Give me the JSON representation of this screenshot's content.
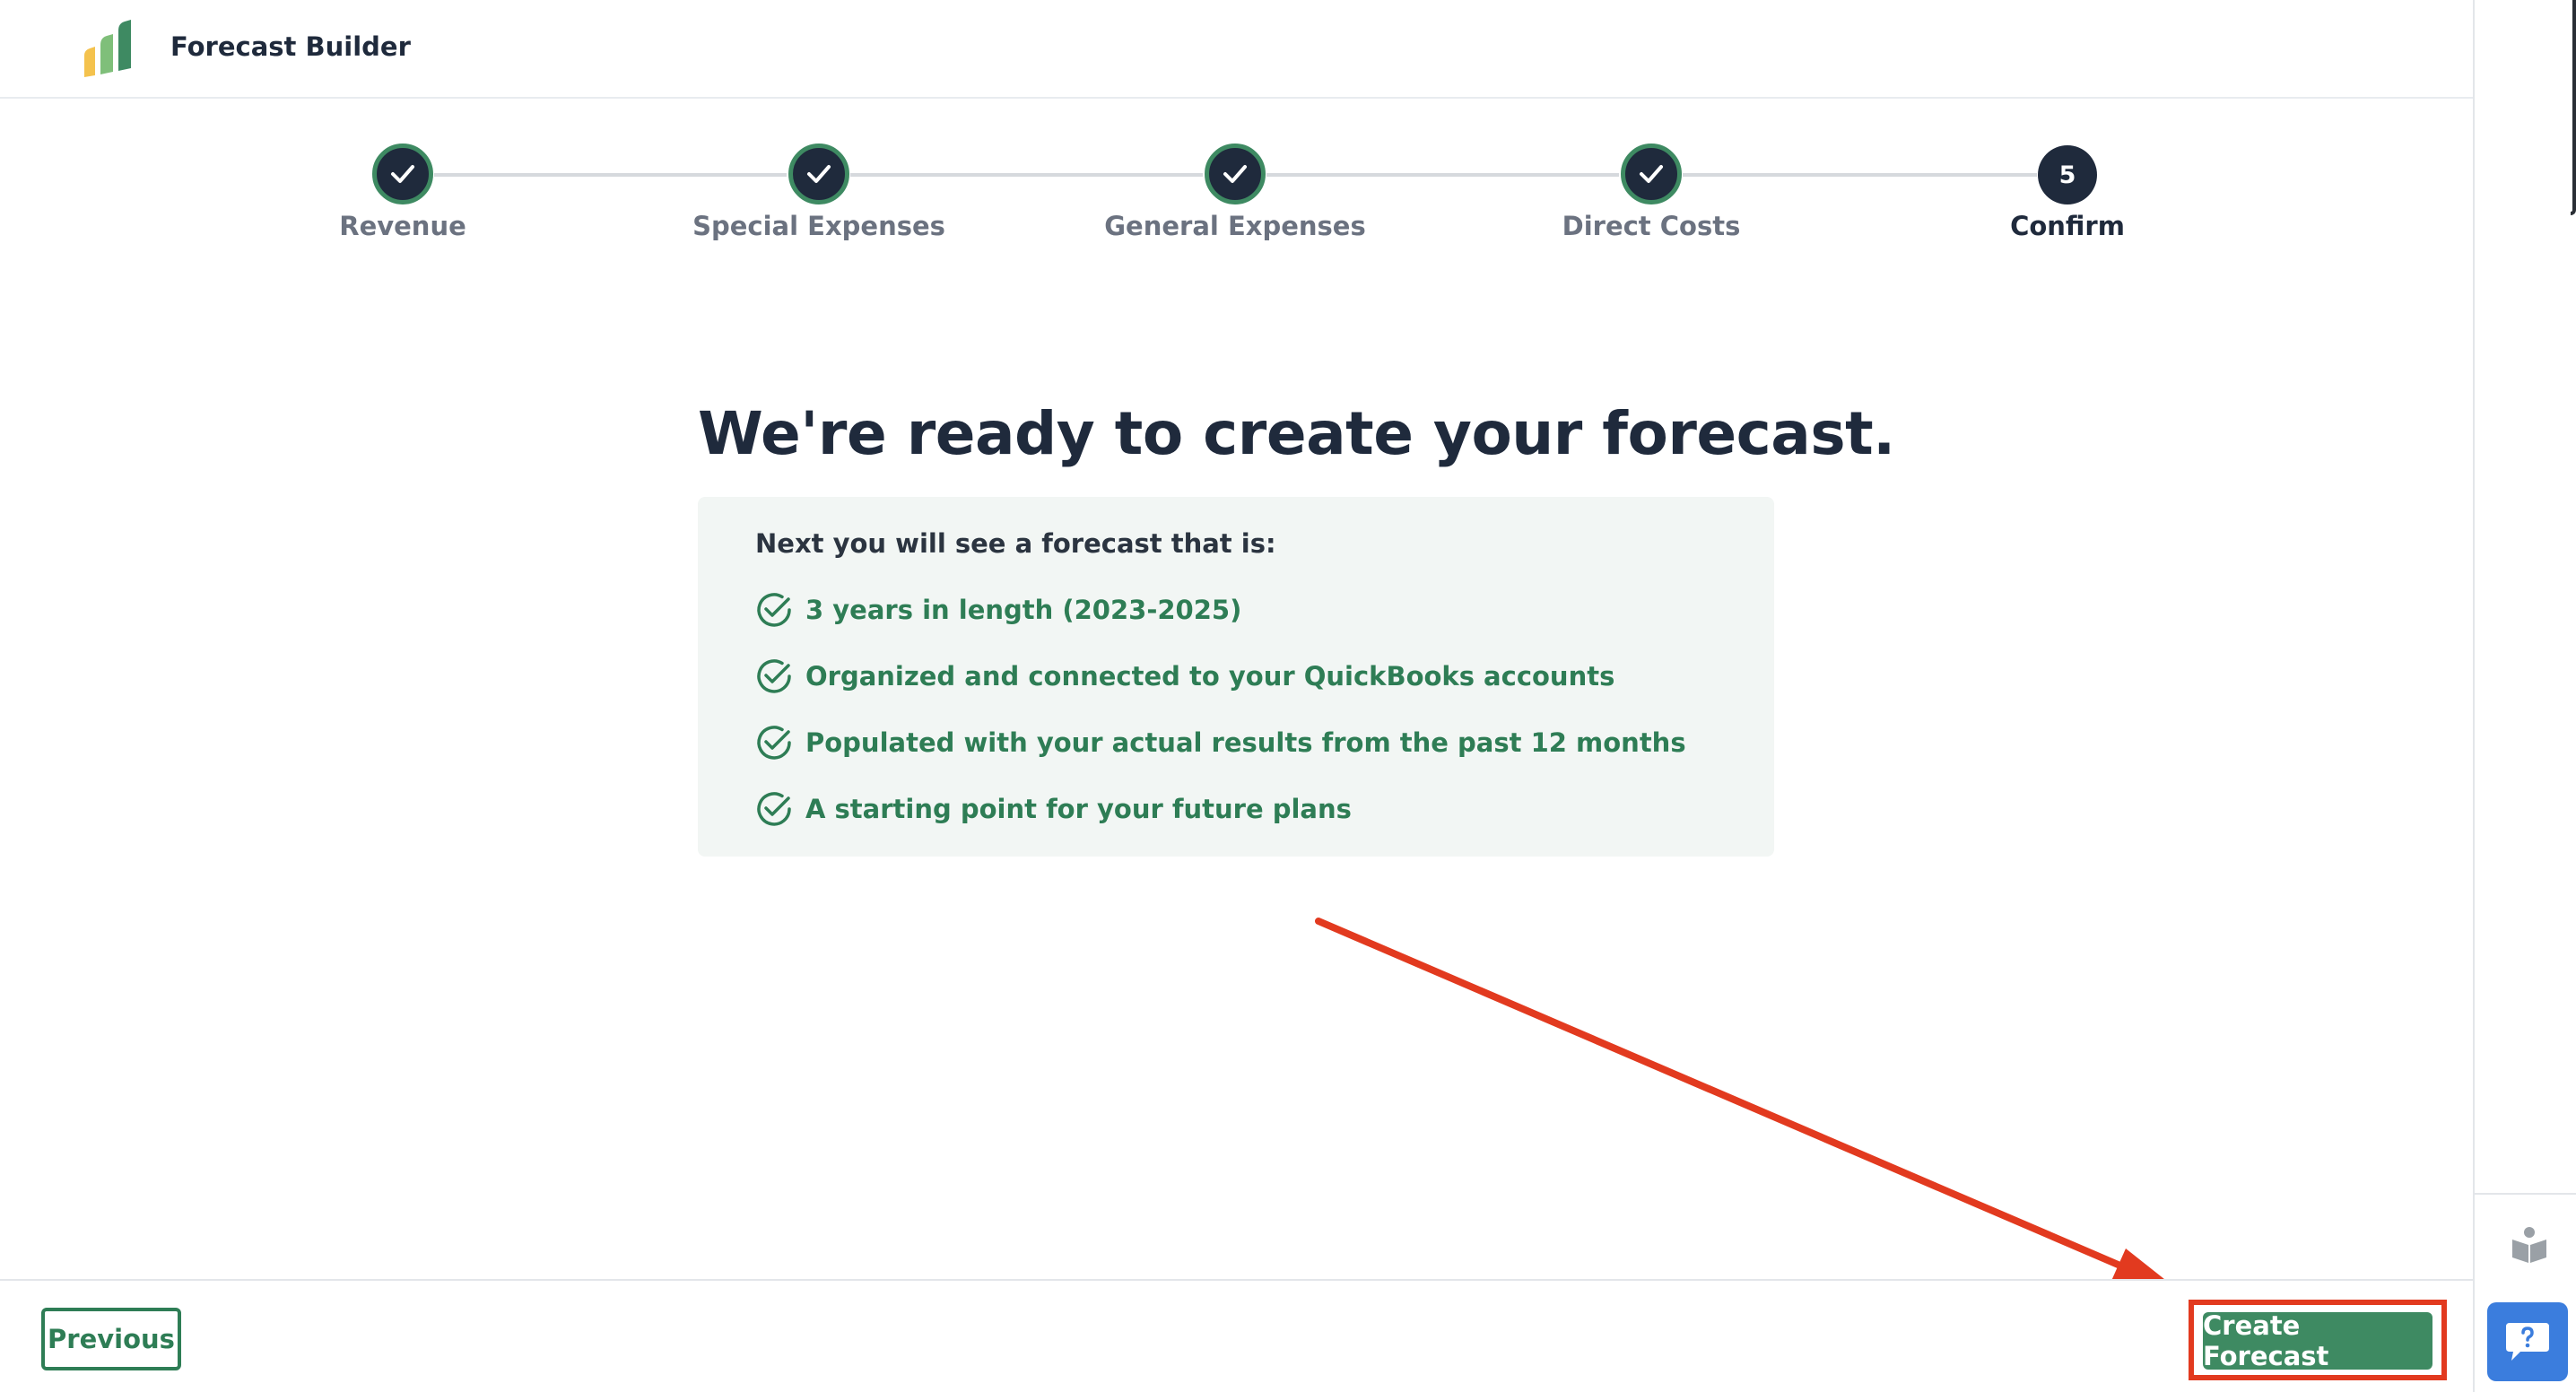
{
  "header": {
    "app_title": "Forecast Builder",
    "logo_icon": "bar-chart-logo-icon"
  },
  "stepper": {
    "steps": [
      {
        "label": "Revenue",
        "status": "complete"
      },
      {
        "label": "Special Expenses",
        "status": "complete"
      },
      {
        "label": "General Expenses",
        "status": "complete"
      },
      {
        "label": "Direct Costs",
        "status": "complete"
      },
      {
        "label": "Confirm",
        "status": "current",
        "number": "5"
      }
    ]
  },
  "main": {
    "headline": "We're ready to create your forecast.",
    "summary_intro": "Next you will see a forecast that is:",
    "checklist": [
      "3 years in length (2023-2025)",
      "Organized and connected to your QuickBooks accounts",
      "Populated with your actual results from the past 12 months",
      "A starting point for your future plans"
    ]
  },
  "footer": {
    "previous_label": "Previous",
    "create_label": "Create Forecast"
  },
  "right_rail": {
    "icons": [
      "book-icon",
      "help-chat-icon"
    ]
  },
  "colors": {
    "brand_green": "#3e8a62",
    "navy": "#1f2a3c",
    "annotation_red": "#e23a1f",
    "help_blue": "#3b7ddd"
  }
}
